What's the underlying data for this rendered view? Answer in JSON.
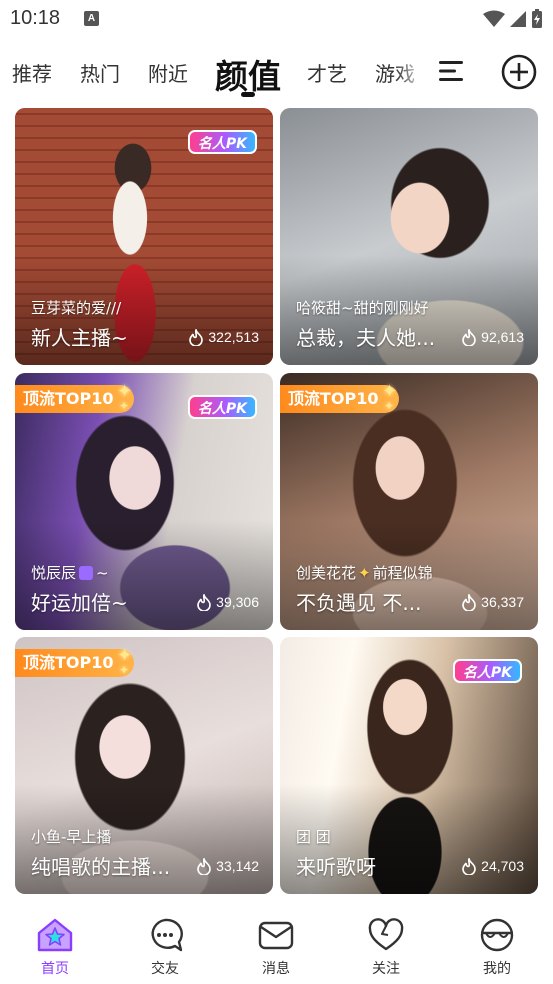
{
  "status_bar": {
    "time": "10:18",
    "notification_letter": "A"
  },
  "tabs": [
    {
      "label": "推荐"
    },
    {
      "label": "热门"
    },
    {
      "label": "附近"
    },
    {
      "label": "颜值",
      "active": true
    },
    {
      "label": "才艺"
    },
    {
      "label": "游戏"
    }
  ],
  "badges": {
    "pk": "名人PK",
    "top": "顶流TOP10"
  },
  "cards": [
    {
      "name": "豆芽菜的爱///",
      "title": "新人主播~",
      "views": "322,513",
      "pk": true,
      "top": false
    },
    {
      "name": "哈筱甜~甜的刚刚好",
      "title": "总裁，夫人她...",
      "views": "92,613",
      "pk": false,
      "top": false
    },
    {
      "name": "悦辰辰",
      "name_suffix": "~",
      "title": "好运加倍~",
      "views": "39,306",
      "pk": true,
      "top": true
    },
    {
      "name": "创美花花",
      "name_suffix": "前程似锦",
      "title": "不负遇见 不...",
      "views": "36,337",
      "pk": false,
      "top": true
    },
    {
      "name": "小鱼-早上播",
      "title": "纯唱歌的主播...",
      "views": "33,142",
      "pk": false,
      "top": true
    },
    {
      "name": "团 团",
      "title": "来听歌呀",
      "views": "24,703",
      "pk": true,
      "top": false
    }
  ],
  "bottom_nav": [
    {
      "label": "首页",
      "icon": "home-icon",
      "active": true
    },
    {
      "label": "交友",
      "icon": "chat-bubble-icon"
    },
    {
      "label": "消息",
      "icon": "envelope-icon"
    },
    {
      "label": "关注",
      "icon": "heart-icon"
    },
    {
      "label": "我的",
      "icon": "profile-glasses-icon"
    }
  ],
  "colors": {
    "accent": "#8b3dff",
    "top_badge": "#ff8a1d",
    "pk_badge": "#ff3e8e"
  }
}
